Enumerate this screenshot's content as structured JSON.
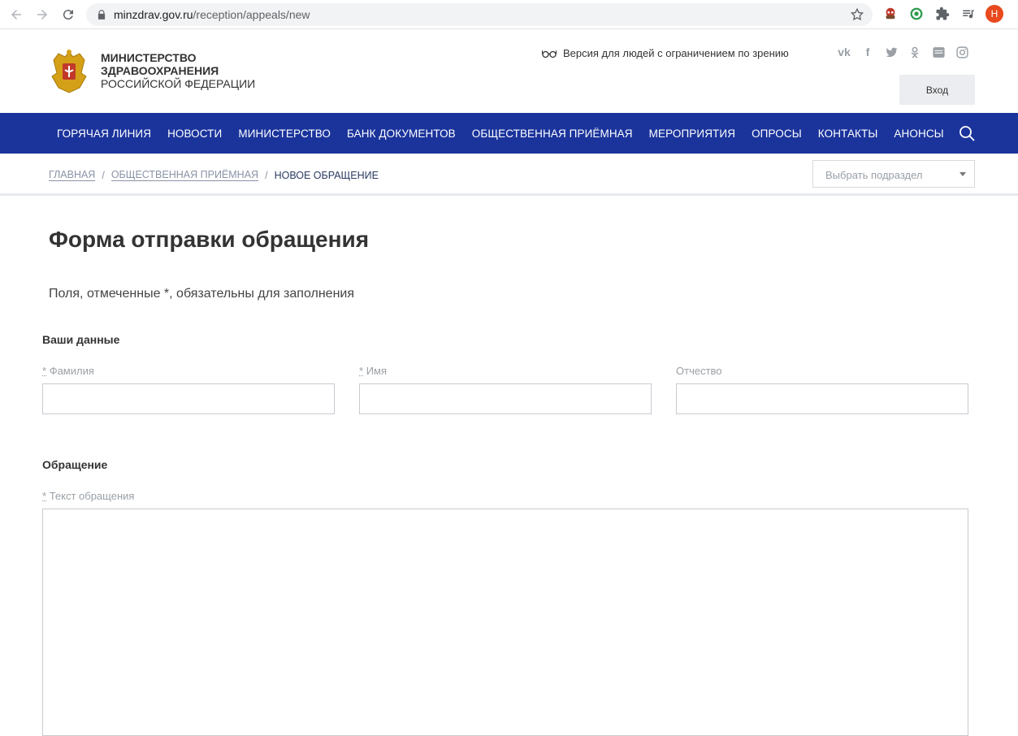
{
  "browser": {
    "url_host": "minzdrav.gov.ru",
    "url_path": "/reception/appeals/new",
    "profile_initial": "H"
  },
  "header": {
    "ministry_line1": "МИНИСТЕРСТВО",
    "ministry_line2": "ЗДРАВООХРАНЕНИЯ",
    "ministry_line3": "РОССИЙСКОЙ ФЕДЕРАЦИИ",
    "vision_link": "Версия для людей с ограничением по зрению",
    "login_label": "Вход",
    "socials": [
      "vk-icon",
      "facebook-icon",
      "twitter-icon",
      "odnoklassniki-icon",
      "youtube-icon",
      "instagram-icon"
    ]
  },
  "nav": {
    "items": [
      "ГОРЯЧАЯ ЛИНИЯ",
      "НОВОСТИ",
      "МИНИСТЕРСТВО",
      "БАНК ДОКУМЕНТОВ",
      "ОБЩЕСТВЕННАЯ ПРИЁМНАЯ",
      "МЕРОПРИЯТИЯ",
      "ОПРОСЫ",
      "КОНТАКТЫ",
      "АНОНСЫ"
    ]
  },
  "breadcrumb": {
    "home": "ГЛАВНАЯ",
    "section": "ОБЩЕСТВЕННАЯ ПРИЁМНАЯ",
    "current": "НОВОЕ ОБРАЩЕНИЕ",
    "separator": "/"
  },
  "subsection_select": {
    "placeholder": "Выбрать подраздел"
  },
  "form": {
    "title": "Форма отправки обращения",
    "required_note": "Поля, отмеченные *, обязательны для заполнения",
    "personal_section": "Ваши данные",
    "required_mark": "*",
    "surname_label": "Фамилия",
    "name_label": "Имя",
    "patronymic_label": "Отчество",
    "surname_value": "",
    "name_value": "",
    "patronymic_value": "",
    "appeal_section": "Обращение",
    "appeal_text_label": "Текст обращения",
    "appeal_text_value": ""
  },
  "colors": {
    "nav_bg": "#1b349c",
    "login_bg": "#ebedf0",
    "label_gray": "#9aa0a6"
  }
}
